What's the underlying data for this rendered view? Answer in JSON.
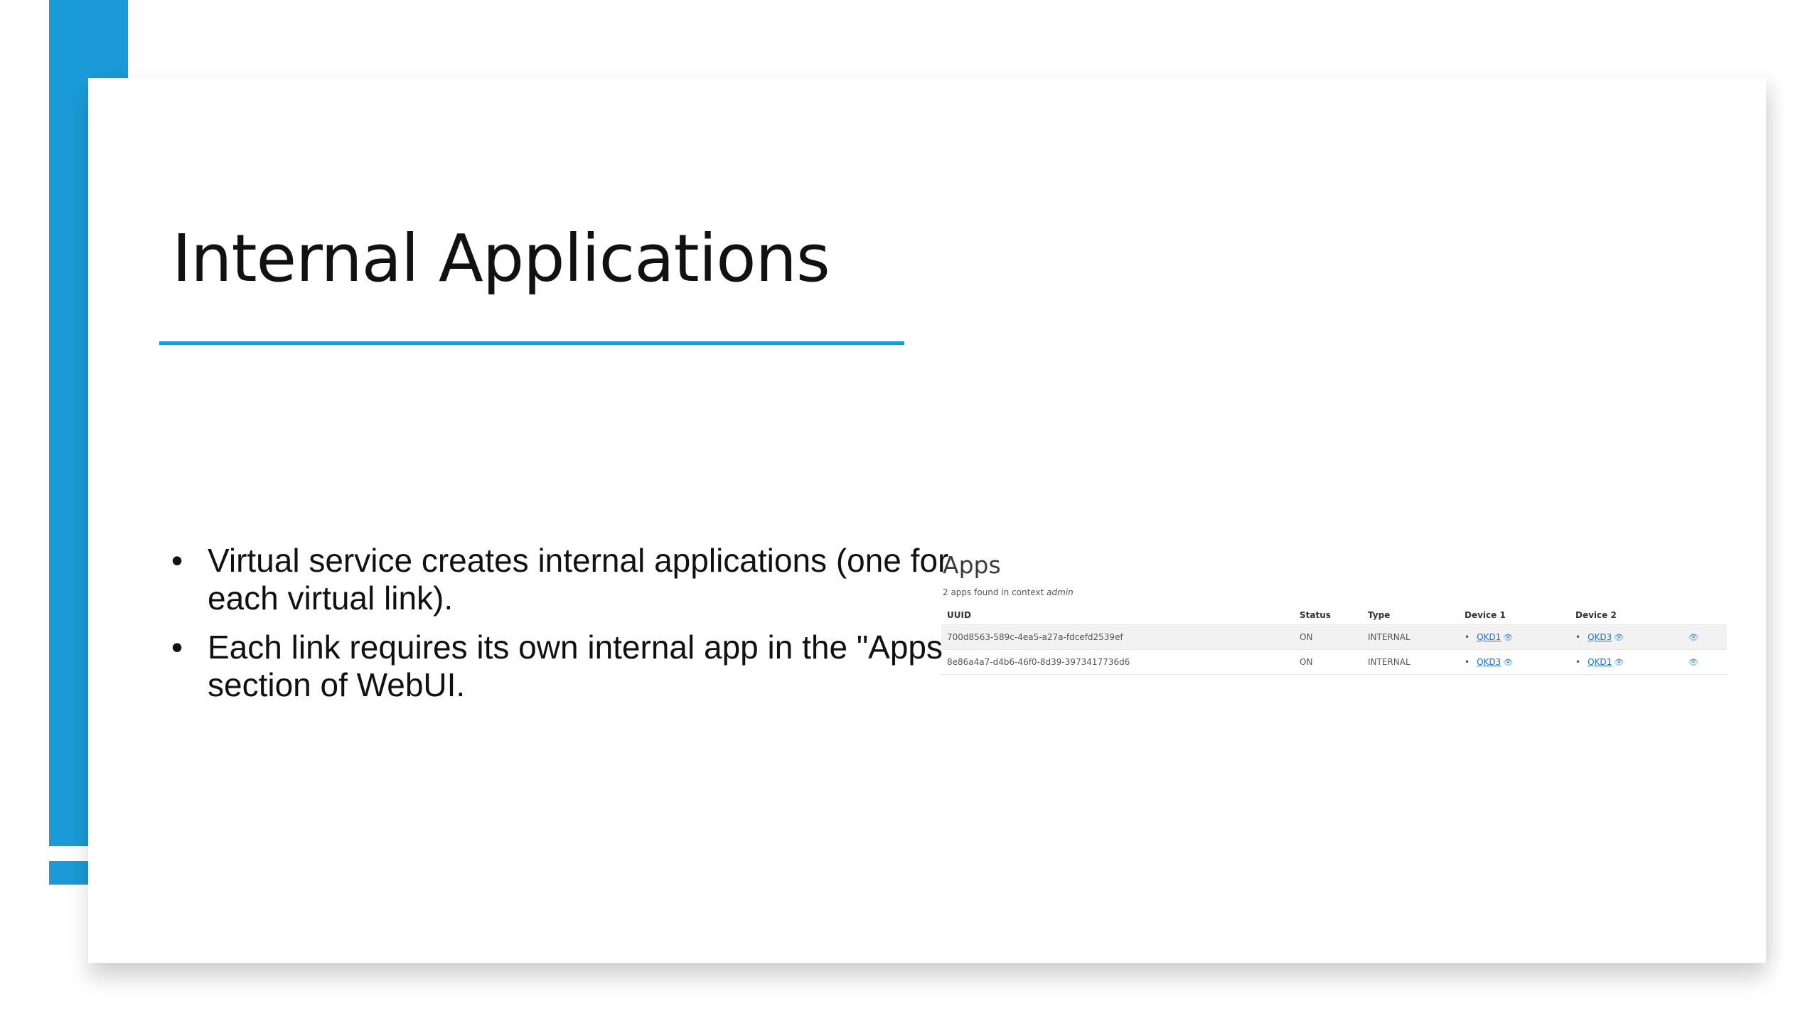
{
  "slide": {
    "title": "Internal Applications",
    "bullets": [
      "Virtual service creates internal applications (one for each virtual link).",
      "Each link requires its own internal app in the \"Apps\" section of WebUI."
    ],
    "bullet_symbol": "•"
  },
  "apps_panel": {
    "title": "Apps",
    "subtitle_prefix": "2 apps found in context ",
    "context_name": "admin",
    "columns": [
      "UUID",
      "Status",
      "Type",
      "Device 1",
      "Device 2",
      ""
    ],
    "rows": [
      {
        "uuid": "700d8563-589c-4ea5-a27a-fdcefd2539ef",
        "status": "ON",
        "type": "INTERNAL",
        "device1": "QKD1",
        "device2": "QKD3"
      },
      {
        "uuid": "8e86a4a7-d4b6-46f0-8d39-3973417736d6",
        "status": "ON",
        "type": "INTERNAL",
        "device1": "QKD3",
        "device2": "QKD1"
      }
    ],
    "list_symbol": "•",
    "eye_glyph": "👁"
  },
  "colors": {
    "accent_blue": "#1a9ad6",
    "link_blue": "#1a6fc4"
  }
}
